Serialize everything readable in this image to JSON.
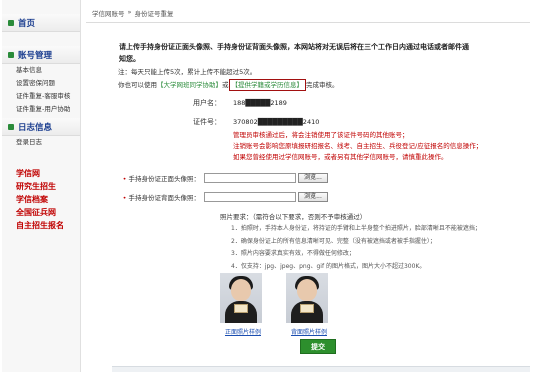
{
  "sidebar": {
    "home": "首页",
    "sections": [
      {
        "title": "账号管理",
        "items": [
          "基本信息",
          "设置密保问题",
          "证件重复-客服审核",
          "证件重复-用户协助"
        ]
      },
      {
        "title": "日志信息",
        "items": [
          "登录日志"
        ]
      }
    ],
    "links": [
      "学信网",
      "研究生招生",
      "学信档案",
      "全国征兵网",
      "自主招生报名"
    ]
  },
  "breadcrumb": {
    "site": "学信网账号",
    "sep": "»",
    "page": "身份证号重复"
  },
  "intro": "请上传手持身份证正面头像照、手持身份证背面头像照，本网站将对无误后将在三个工作日内通过电话或者邮件通知您。",
  "note": "注：每天只能上传5次，累计上传不能超过5次。",
  "note2": {
    "prefix": "你也可以使用",
    "link1": "【大学网班同学协助】",
    "mid": "或",
    "link2": "【提供学籍或学历信息】",
    "suffix": "完成审核。"
  },
  "fields": {
    "username_label": "用户名：",
    "username_value": "188█████2189",
    "id_label": "证件号：",
    "id_value": "370802█████████2410"
  },
  "warning_lines": [
    "管理员审核通过后，将会注销使用了该证件号码的其他账号；",
    "注销账号会影响您原填报研招报名、线考、自主招生、兵役登记/应征报名的信息操作；",
    "如果您曾经使用过学信网账号，或者另有其他学信网账号，请慎重此操作。"
  ],
  "uploads": {
    "front_label": "手持身份证正面头像照：",
    "back_label": "手持身份证背面头像照：",
    "browse": "浏览..."
  },
  "requirements": {
    "title": "照片要求：（需符合以下要求，否则不予审核通过）",
    "items": [
      "1．拍照时，手持本人身份证，将持证的手臂和上半身整个拍进照片，脸部清晰且不能被遮挡；",
      "2．确保身份证上的所有信息清晰可见、完整（没有被遮挡或者被手指握住）；",
      "3．照片内容要求真实有效，不得做任何修改；",
      "4．仅支持：jpg、jpeg、png、gif 的图片格式，图片大小不超过300K。"
    ]
  },
  "samples": {
    "front": "正面照片样例",
    "back": "背面照片样例"
  },
  "submit_label": "提交"
}
